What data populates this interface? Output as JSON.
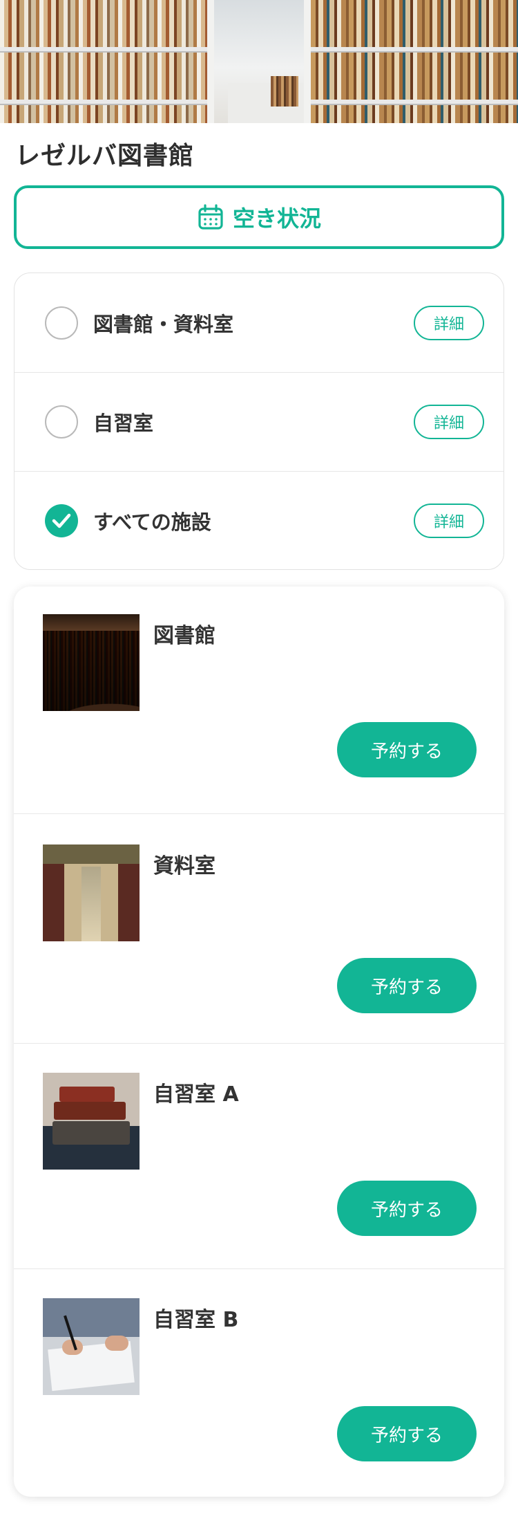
{
  "app": {
    "title": "レゼルバ図書館"
  },
  "availability_button": {
    "label": "空き状況",
    "icon": "calendar-icon"
  },
  "filters": [
    {
      "label": "図書館・資料室",
      "checked": false,
      "detail_label": "詳細"
    },
    {
      "label": "自習室",
      "checked": false,
      "detail_label": "詳細"
    },
    {
      "label": "すべての施設",
      "checked": true,
      "detail_label": "詳細"
    }
  ],
  "facilities": [
    {
      "name": "図書館",
      "reserve_label": "予約する",
      "image": "library-bookshelves-photo"
    },
    {
      "name": "資料室",
      "reserve_label": "予約する",
      "image": "reading-room-photo"
    },
    {
      "name": "自習室 A",
      "reserve_label": "予約する",
      "image": "stacked-books-photo"
    },
    {
      "name": "自習室 B",
      "reserve_label": "予約する",
      "image": "writing-hand-photo"
    }
  ],
  "colors": {
    "accent": "#12b595",
    "text": "#333333",
    "border": "#e2e2e2"
  }
}
